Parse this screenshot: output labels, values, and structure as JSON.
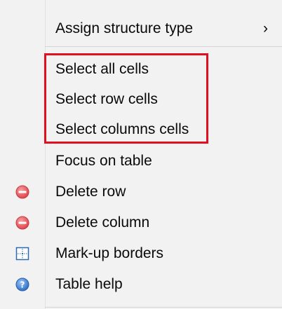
{
  "menu": {
    "items": [
      {
        "label": "Assign structure type",
        "submenu_arrow": "›",
        "icon": null
      },
      {
        "label": "Select all cells",
        "icon": null
      },
      {
        "label": "Select row cells",
        "icon": null
      },
      {
        "label": "Select columns cells",
        "icon": null
      },
      {
        "label": "Focus on table",
        "icon": null
      },
      {
        "label": "Delete row",
        "icon": "delete-circle-icon"
      },
      {
        "label": "Delete column",
        "icon": "delete-circle-icon"
      },
      {
        "label": "Mark-up borders",
        "icon": "table-borders-icon"
      },
      {
        "label": "Table help",
        "icon": "help-circle-icon"
      }
    ]
  },
  "colors": {
    "menu_background": "#f2f2f2",
    "highlight_border": "#e2101f",
    "delete_icon": "#e8555a",
    "help_icon": "#3b7fd4",
    "borders_icon": "#2b6cb0"
  }
}
